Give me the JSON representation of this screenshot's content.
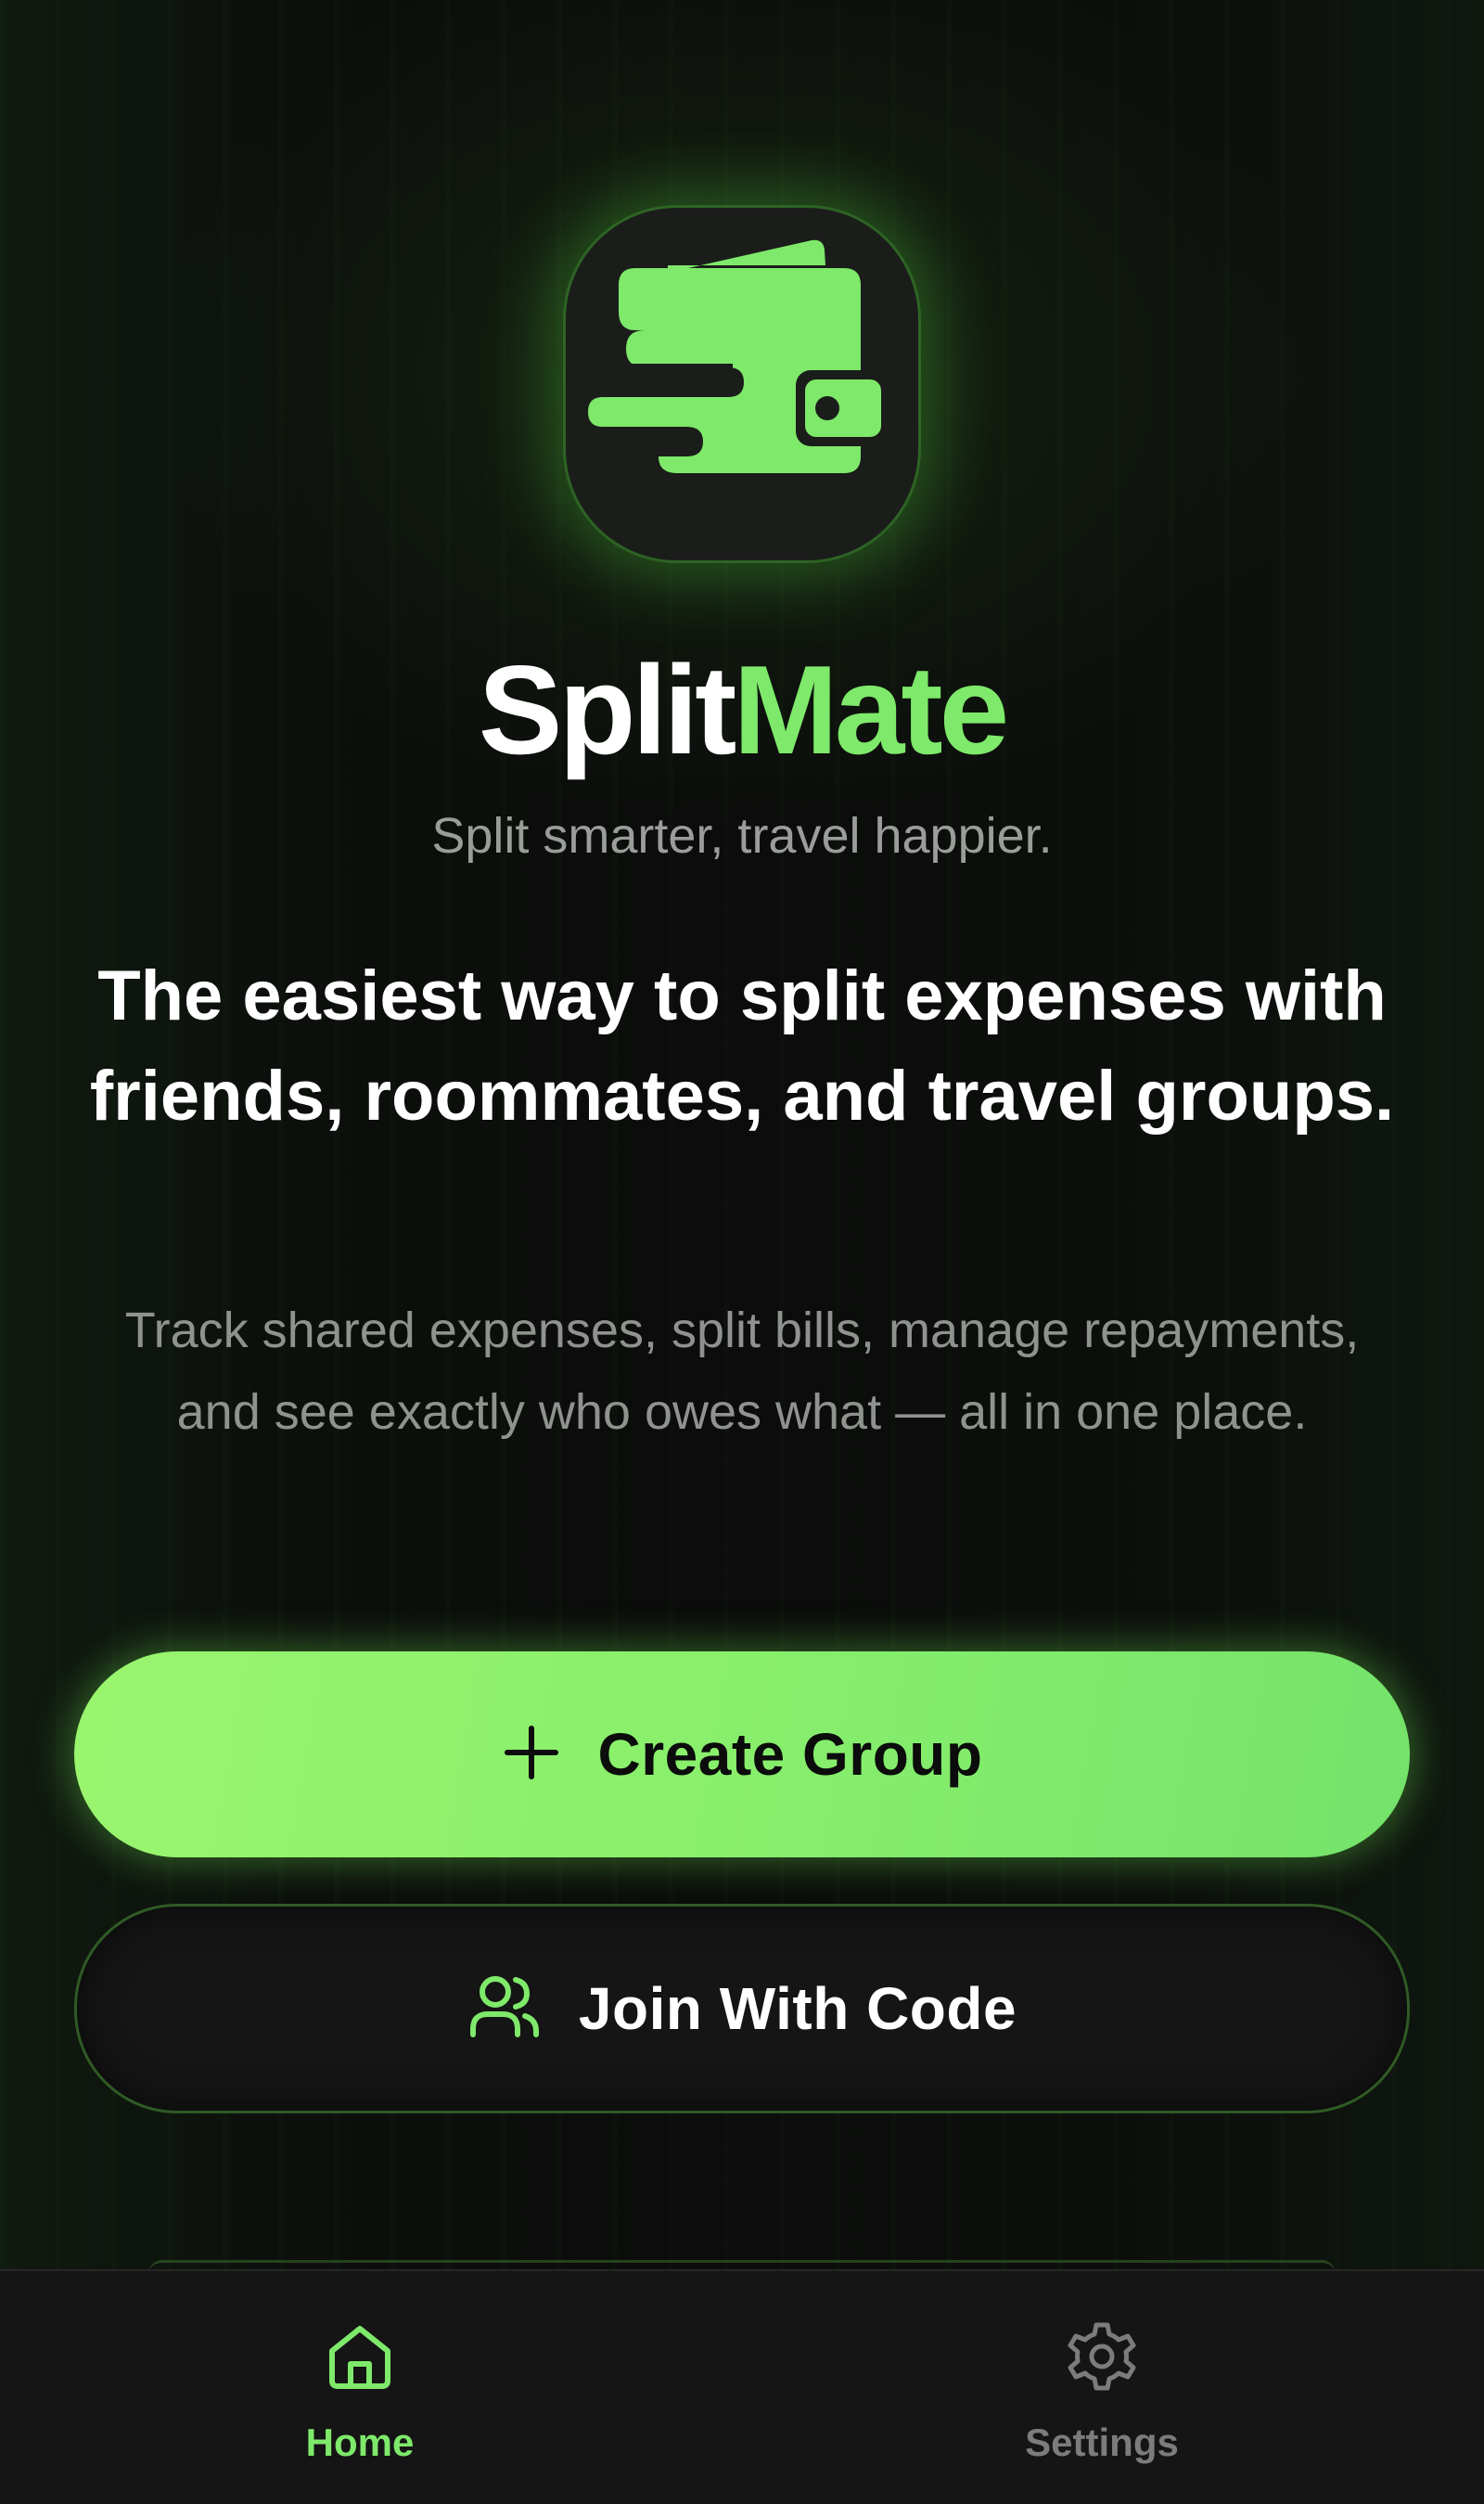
{
  "app": {
    "name_part1": "Split",
    "name_part2": "Mate",
    "tagline": "Split smarter, travel happier.",
    "headline": "The easiest way to split expenses with friends, roommates, and travel groups.",
    "description": "Track shared expenses, split bills, manage repayments, and see exactly who owes what — all in one place."
  },
  "actions": {
    "create_group_label": "Create Group",
    "create_group_icon": "plus-icon",
    "join_code_label": "Join With Code",
    "join_code_icon": "users-icon"
  },
  "tabbar": {
    "items": [
      {
        "label": "Home",
        "icon": "home-icon",
        "active": true
      },
      {
        "label": "Settings",
        "icon": "gear-icon",
        "active": false
      }
    ]
  },
  "colors": {
    "accent": "#7ee96a",
    "background": "#0b0d0b",
    "logo_bg": "#1b1d1b",
    "inactive": "#7a7d7a"
  }
}
